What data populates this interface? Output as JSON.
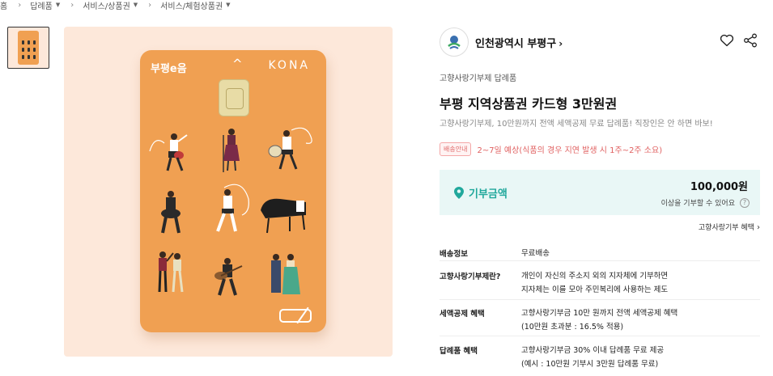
{
  "breadcrumb": [
    {
      "label": "홈",
      "dropdown": false
    },
    {
      "label": "답례품",
      "dropdown": true
    },
    {
      "label": "서비스/상품권",
      "dropdown": true
    },
    {
      "label": "서비스/체험상품권",
      "dropdown": true
    }
  ],
  "card": {
    "brand": "부평e음",
    "issuer": "KONA",
    "color": "#f0a052"
  },
  "seller": {
    "name": "인천광역시 부평구",
    "arrow": "›"
  },
  "actions": {
    "like_icon": "heart-icon",
    "share_icon": "share-icon"
  },
  "product": {
    "category": "고향사랑기부제 답례품",
    "title": "부평 지역상품권 카드형 3만원권",
    "subtitle": "고향사랑기부제, 10만원까지 전액 세액공제 무료 답례품! 직장인은 안 하면 바보!"
  },
  "shipping": {
    "badge": "배송안내",
    "text": "2~7일 예상(식품의 경우 지연 발생 시 1주~2주 소요)"
  },
  "donation": {
    "label": "기부금액",
    "amount": "100,000원",
    "note": "이상을 기부할 수 있어요",
    "help": "?",
    "accent": "#21a89c"
  },
  "benefit_link": {
    "label": "고향사랑기부 혜택",
    "arrow": "›"
  },
  "info_rows": [
    {
      "label": "배송정보",
      "lines": [
        "무료배송"
      ]
    },
    {
      "label": "고향사랑기부제란?",
      "lines": [
        "개인이 자신의 주소지 외의 지자체에 기부하면",
        "지자체는 이를 모아 주민복리에 사용하는 제도"
      ]
    },
    {
      "label": "세액공제 혜택",
      "lines": [
        "고향사랑기부금 10만 원까지 전액 세액공제 혜택",
        "(10만원 초과분 : 16.5% 적용)"
      ]
    },
    {
      "label": "답례품 혜택",
      "lines": [
        "고향사랑기부금 30% 이내 답례품 무료 제공",
        "(예시 : 10만원 기부시 3만원 답례품 무료)"
      ]
    }
  ]
}
